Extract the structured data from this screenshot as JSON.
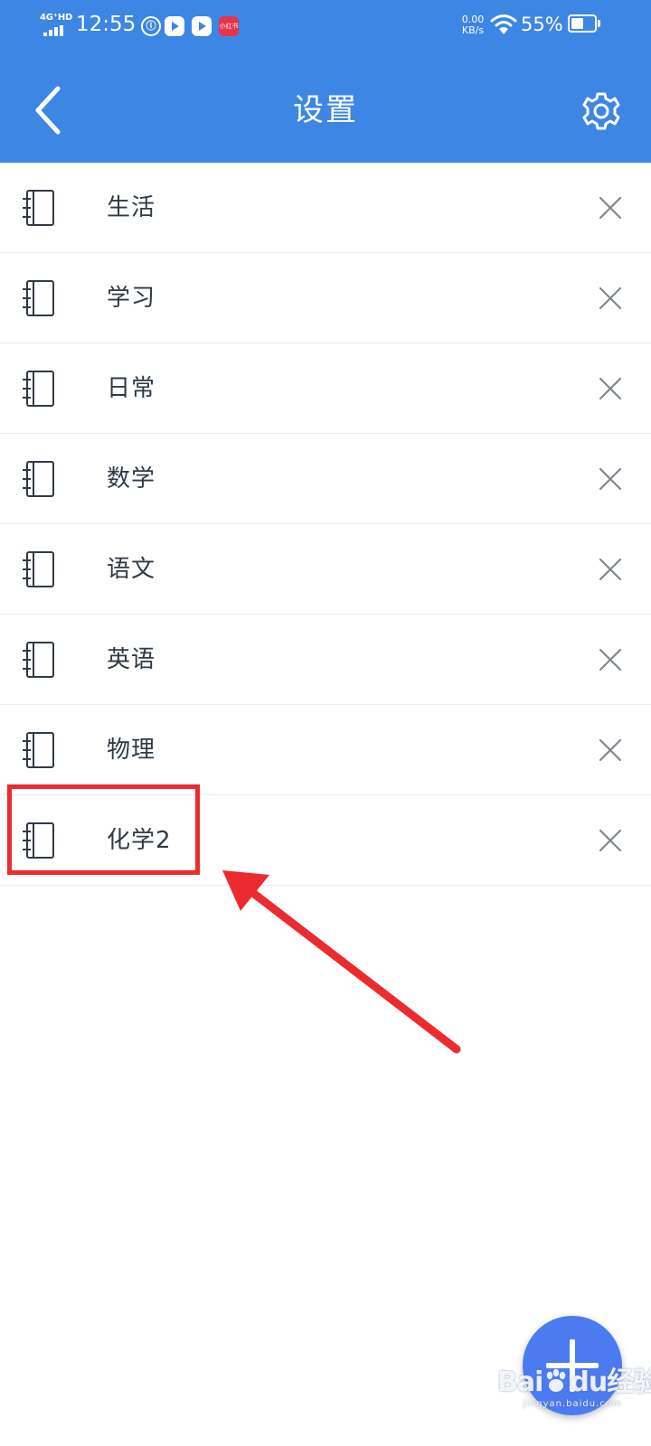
{
  "status_bar": {
    "network": "4G⁺HD",
    "time": "12:55",
    "notification_badge": "小红书",
    "net_speed_value": "0.00",
    "net_speed_unit": "KB/s",
    "battery_percent": "55%",
    "battery_level": 0.55
  },
  "app_bar": {
    "title": "设置",
    "back_icon": "chevron-left-icon",
    "settings_icon": "gear-icon"
  },
  "notebooks": [
    {
      "label": "生活",
      "icon": "notebook-icon",
      "delete_icon": "close-icon"
    },
    {
      "label": "学习",
      "icon": "notebook-icon",
      "delete_icon": "close-icon"
    },
    {
      "label": "日常",
      "icon": "notebook-icon",
      "delete_icon": "close-icon"
    },
    {
      "label": "数学",
      "icon": "notebook-icon",
      "delete_icon": "close-icon"
    },
    {
      "label": "语文",
      "icon": "notebook-icon",
      "delete_icon": "close-icon"
    },
    {
      "label": "英语",
      "icon": "notebook-icon",
      "delete_icon": "close-icon"
    },
    {
      "label": "物理",
      "icon": "notebook-icon",
      "delete_icon": "close-icon"
    },
    {
      "label": "化学2",
      "icon": "notebook-icon",
      "delete_icon": "close-icon"
    }
  ],
  "fab": {
    "icon": "plus-icon"
  },
  "watermark": {
    "text_left": "Bai",
    "text_mid": "du",
    "text_right": "经验",
    "sub": "jingyan.baidu.com"
  },
  "colors": {
    "primary": "#3d86e3",
    "fab": "#4c7bf1",
    "annotation": "#ec2b30",
    "divider": "#ececec",
    "text": "#2f3a45"
  }
}
